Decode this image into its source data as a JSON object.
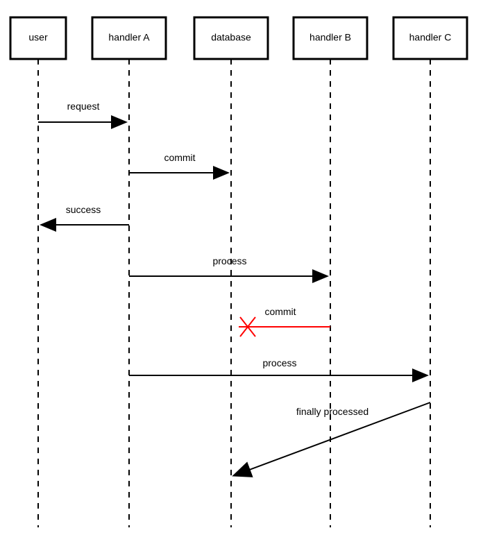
{
  "diagram": {
    "type": "sequence",
    "participants": [
      {
        "id": "user",
        "label": "user"
      },
      {
        "id": "handlerA",
        "label": "handler A"
      },
      {
        "id": "database",
        "label": "database"
      },
      {
        "id": "handlerB",
        "label": "handler B"
      },
      {
        "id": "handlerC",
        "label": "handler C"
      }
    ],
    "messages": [
      {
        "from": "user",
        "to": "handlerA",
        "label": "request",
        "status": "ok"
      },
      {
        "from": "handlerA",
        "to": "database",
        "label": "commit",
        "status": "ok"
      },
      {
        "from": "handlerA",
        "to": "user",
        "label": "success",
        "status": "ok"
      },
      {
        "from": "handlerA",
        "to": "handlerB",
        "label": "process",
        "status": "ok"
      },
      {
        "from": "handlerB",
        "to": "database",
        "label": "commit",
        "status": "failed"
      },
      {
        "from": "handlerA",
        "to": "handlerC",
        "label": "process",
        "status": "ok"
      },
      {
        "from": "handlerC",
        "to": "database",
        "label": "finally processed",
        "status": "ok"
      }
    ]
  }
}
